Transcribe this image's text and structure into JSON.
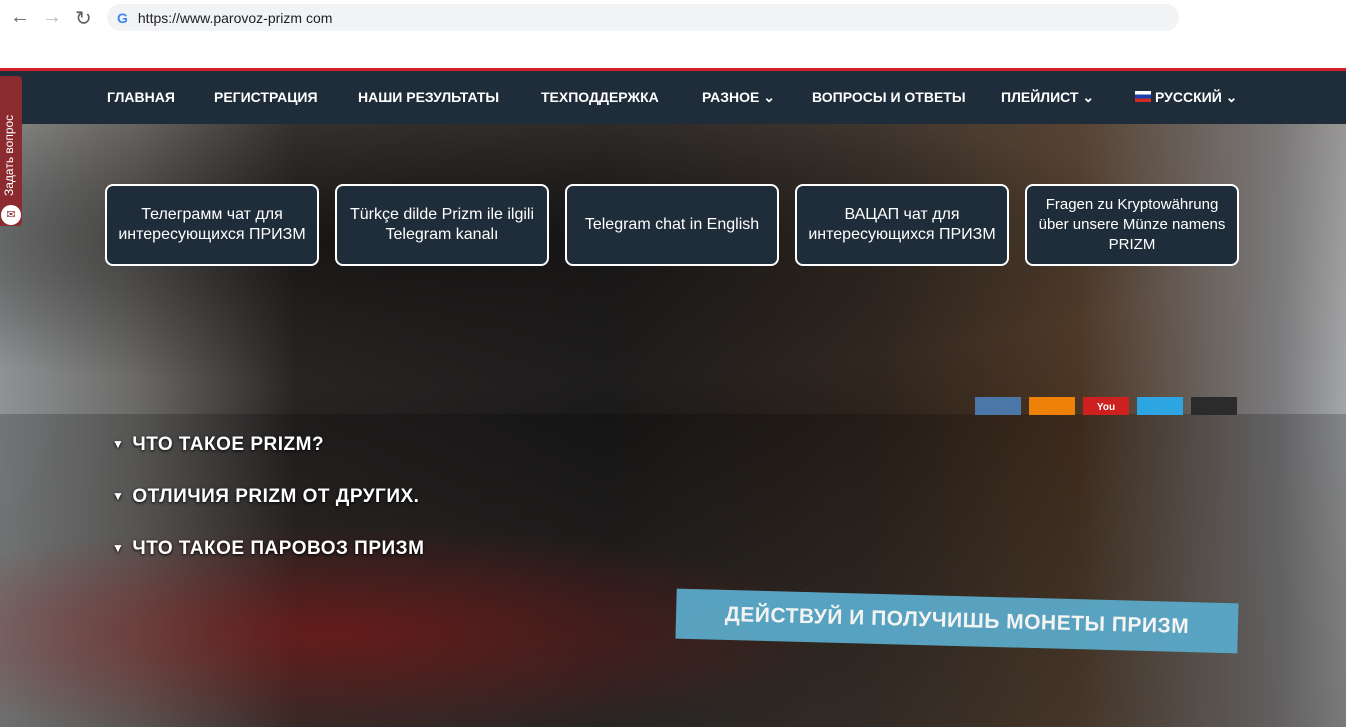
{
  "browser": {
    "url": "https://www.parovoz-prizm com",
    "back": "←",
    "forward": "→",
    "reload": "↻"
  },
  "menu": {
    "items": [
      {
        "label": "ГЛАВНАЯ"
      },
      {
        "label": "РЕГИСТРАЦИЯ"
      },
      {
        "label": "НАШИ РЕЗУЛЬТАТЫ"
      },
      {
        "label": "ТЕХПОДДЕРЖКА"
      },
      {
        "label": "РАЗНОЕ ⌄"
      },
      {
        "label": "ВОПРОСЫ И ОТВЕТЫ"
      },
      {
        "label": "ПЛЕЙЛИСТ ⌄"
      },
      {
        "label": "РУССКИЙ ⌄"
      }
    ]
  },
  "side_tab": {
    "label": "Задать вопрос"
  },
  "chats": [
    {
      "label": "Телеграмм чат для интересующихся ПРИЗМ"
    },
    {
      "label": "Türkçe dilde Prizm ile ilgili Telegram kanalı"
    },
    {
      "label": "Telegram chat in English"
    },
    {
      "label": "ВАЦАП чат для интересующихся ПРИЗМ"
    },
    {
      "label": "Fragen zu Kryptowährung über unsere Münze namens PRIZM"
    }
  ],
  "social": [
    {
      "icon": "vk-icon",
      "color": "#4a76a8",
      "text": ""
    },
    {
      "icon": "odnoklassniki-icon",
      "color": "#ee8208",
      "text": ""
    },
    {
      "icon": "youtube-icon",
      "color": "#cd201f",
      "text": "You"
    },
    {
      "icon": "telegram-icon",
      "color": "#2ca5e0",
      "text": ""
    },
    {
      "icon": "instagram-icon",
      "color": "#2b2b2b",
      "text": ""
    }
  ],
  "accordion": [
    {
      "label": "ЧТО ТАКОЕ PRIZM?"
    },
    {
      "label": "ОТЛИЧИЯ PRIZM ОТ ДРУГИХ."
    },
    {
      "label": "ЧТО ТАКОЕ ПАРОВОЗ ПРИЗМ"
    }
  ],
  "cta": {
    "label": "ДЕЙСТВУЙ И ПОЛУЧИШЬ МОНЕТЫ ПРИЗМ"
  }
}
